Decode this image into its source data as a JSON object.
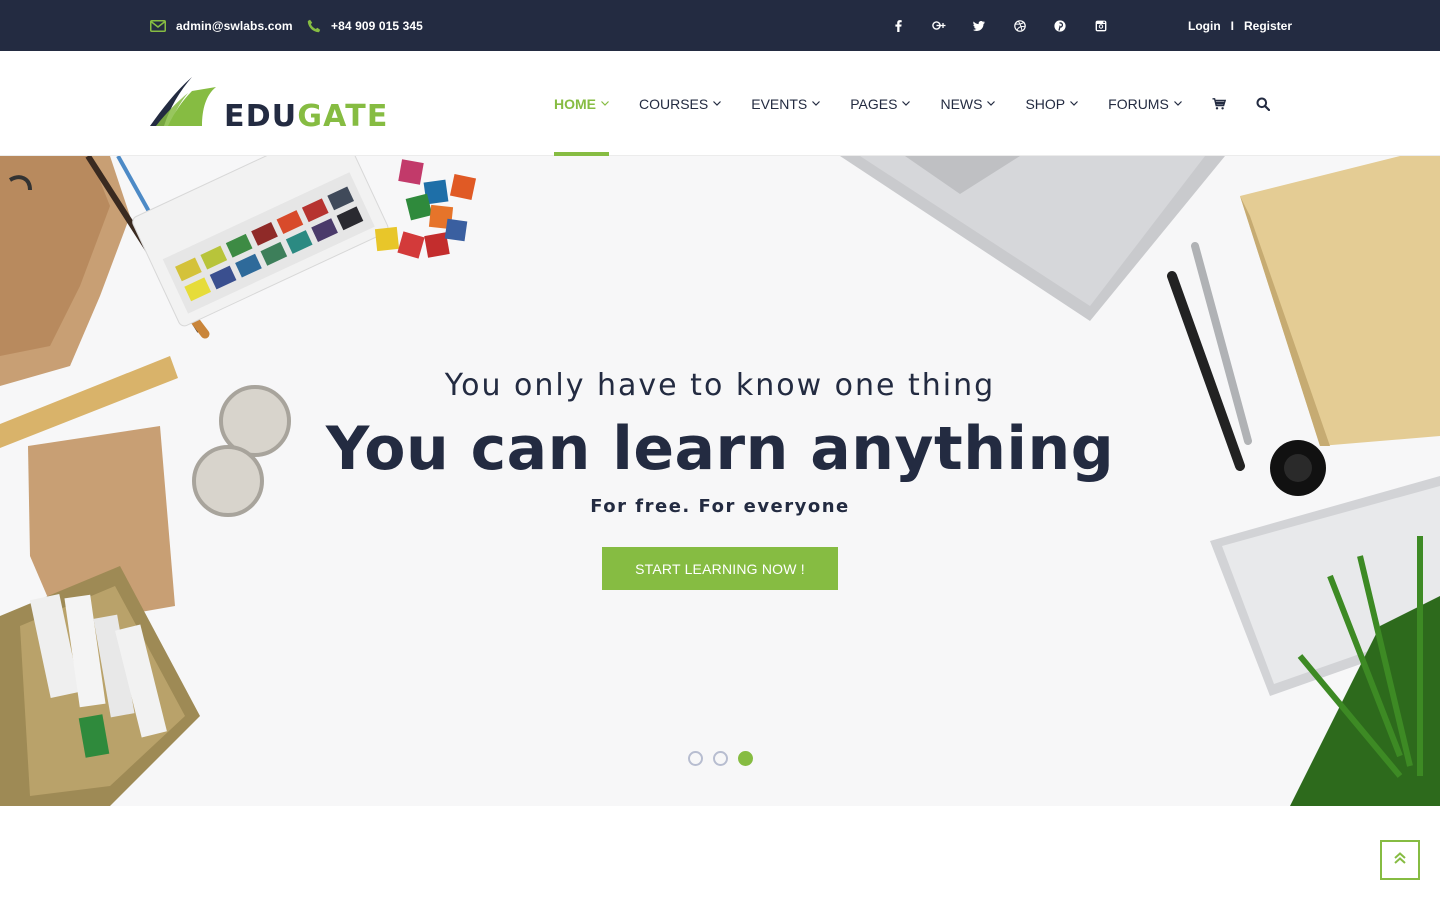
{
  "topbar": {
    "email": "admin@swlabs.com",
    "phone": "+84 909 015 345",
    "social_icons": [
      "facebook-icon",
      "google-plus-icon",
      "twitter-icon",
      "dribbble-icon",
      "pinterest-icon",
      "instagram-icon"
    ],
    "login": "Login",
    "separator": "I",
    "register": "Register"
  },
  "logo": {
    "part1": "EDU",
    "part2": "GATE"
  },
  "nav": {
    "items": [
      {
        "label": "HOME",
        "active": true
      },
      {
        "label": "COURSES"
      },
      {
        "label": "EVENTS"
      },
      {
        "label": "PAGES"
      },
      {
        "label": "NEWS"
      },
      {
        "label": "SHOP"
      },
      {
        "label": "FORUMS"
      }
    ],
    "icons": [
      "cart-icon",
      "search-icon"
    ]
  },
  "hero": {
    "subtitle": "You only have to know one thing",
    "title": "You can learn anything",
    "tagline": "For free. For everyone",
    "cta_label": "START LEARNING NOW !",
    "slides_total": 3,
    "active_slide": 3
  },
  "colors": {
    "navy": "#232b41",
    "accent_green": "#86bc42",
    "hero_bg": "#f7f7f8"
  }
}
